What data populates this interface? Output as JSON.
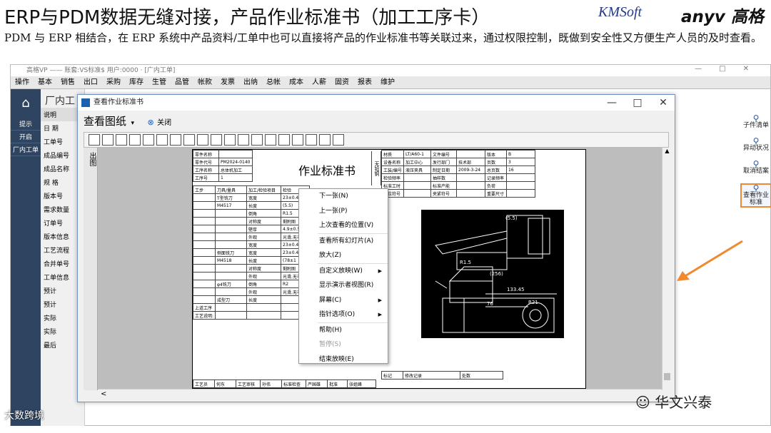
{
  "page": {
    "title": "ERP与PDM数据无缝对接，产品作业标准书（加工工序卡）",
    "logo_brand": "KMSoft",
    "logo_anyv": "anyv 高格",
    "description": "PDM 与 ERP 相结合，在 ERP 系统中产品资料/工单中也可以直接将产品的作业标准书等关联过来，通过权限控制，既做到安全性又方便生产人员的及时查看。"
  },
  "bg_app": {
    "title": "高格VP —— 账套:VS标准$ 用户:0000 · [广内工单]",
    "menu": [
      "操作",
      "基本",
      "销售",
      "出口",
      "采购",
      "库存",
      "生管",
      "品管",
      "帐款",
      "发票",
      "出纳",
      "总帐",
      "成本",
      "人薪",
      "固资",
      "报表",
      "维护"
    ],
    "left_items": [
      "提示",
      "开启",
      "厂内工单"
    ],
    "panel_header": "厂内工",
    "panel_sub": "说明",
    "panel_items": [
      "日 期",
      "工单号",
      "成品编号",
      "成品名称",
      "规 格",
      "版本号",
      "需求数量",
      "订单号",
      "版本信息",
      "工艺流程",
      "合并单号",
      "工单信息",
      "预计",
      "预计",
      "实际",
      "实际",
      "最后"
    ],
    "right_tools": [
      "子件清单",
      "异动状况",
      "取消结案",
      "查看作业标准"
    ]
  },
  "dialog": {
    "title": "查看作业标准书",
    "view_menu": "查看图纸",
    "close_label": "关闭",
    "side_tab": "出图",
    "scroll_left": "<"
  },
  "sheet": {
    "title": "作业标准书",
    "left_labels": [
      "零件名称",
      "零件代号",
      "工序名称",
      "工序号"
    ],
    "left_values": [
      "",
      "PM2024-0140",
      "总体机加工",
      "1"
    ],
    "col_headers": [
      "工步",
      "刀具/量具",
      "加工/检验项目",
      "检验"
    ],
    "rows": [
      [
        "",
        "T型铣刀",
        "宽度",
        "23±0.4"
      ],
      [
        "",
        "M4517",
        "长度",
        "(5.5)"
      ],
      [
        "",
        "",
        "倒角",
        "R1.5"
      ],
      [
        "",
        "",
        "对称度",
        "剩附图"
      ],
      [
        "",
        "",
        "壁厚",
        "4.9±0.5"
      ],
      [
        "",
        "",
        "外观",
        "光滑,无毛"
      ],
      [
        "",
        "",
        "宽度",
        "23±0.4"
      ],
      [
        "",
        "侧面铣刀",
        "宽度",
        "23±0.4"
      ],
      [
        "",
        "M4518",
        "长度",
        "(78±1"
      ],
      [
        "",
        "",
        "对称度",
        "剩附图"
      ],
      [
        "",
        "",
        "外观",
        "光滑,无毛"
      ],
      [
        "",
        "φ4铣刀",
        "倒角",
        "R2"
      ],
      [
        "",
        "",
        "外观",
        "光滑,无毛"
      ],
      [
        "",
        "成型刀",
        "长度",
        ""
      ]
    ],
    "footer_rows": [
      "上道工序",
      "工艺说明:"
    ],
    "bottom_row": [
      "工艺员",
      "何东",
      "工艺审核",
      "孙伟",
      "标准检查",
      "严国雄",
      "批准",
      "张姐峰"
    ],
    "right_info": [
      [
        "材质",
        "LT/A60-1",
        "文件编号",
        "",
        "版本",
        "B"
      ],
      [
        "设备名称",
        "加工中心",
        "发行部门",
        "技术部",
        "页数",
        "3"
      ],
      [
        "工装/编号",
        "液压夹具",
        "制定日期",
        "2009-3-24",
        "总页数",
        "16"
      ],
      [
        "检验频率",
        "",
        "抽样数",
        "",
        "记录频率",
        ""
      ],
      [
        "标准工时",
        "",
        "标准产能",
        "",
        "负荷",
        ""
      ],
      [
        "定位符号",
        "",
        "夹紧符号",
        "",
        "重要尺寸",
        ""
      ]
    ],
    "side_label": "无铅铜",
    "footer_sign": [
      "标记",
      "修改记录",
      "处数"
    ],
    "dims": [
      "(5.5)",
      "R1.5",
      "(256)",
      "133.45",
      "76",
      "R21"
    ]
  },
  "context_menu": [
    {
      "label": "下一张(N)",
      "disabled": false,
      "submenu": false
    },
    {
      "label": "上一张(P)",
      "disabled": false,
      "submenu": false
    },
    {
      "label": "上次查看的位置(V)",
      "disabled": false,
      "submenu": false
    },
    {
      "label": "查看所有幻灯片(A)",
      "disabled": false,
      "submenu": false
    },
    {
      "label": "放大(Z)",
      "disabled": false,
      "submenu": false
    },
    {
      "label": "自定义放映(W)",
      "disabled": false,
      "submenu": true
    },
    {
      "label": "显示演示者视图(R)",
      "disabled": false,
      "submenu": false
    },
    {
      "label": "屏幕(C)",
      "disabled": false,
      "submenu": true
    },
    {
      "label": "指针选项(O)",
      "disabled": false,
      "submenu": true
    },
    {
      "label": "帮助(H)",
      "disabled": false,
      "submenu": false
    },
    {
      "label": "暂停(S)",
      "disabled": true,
      "submenu": false
    },
    {
      "label": "结束放映(E)",
      "disabled": false,
      "submenu": false
    }
  ],
  "watermark": "华文兴泰",
  "watermark_left": "大数跨境",
  "colors": {
    "accent_arrow": "#f08a30",
    "left_bar": "#2e4460",
    "dialog_border": "#6f93c8"
  }
}
